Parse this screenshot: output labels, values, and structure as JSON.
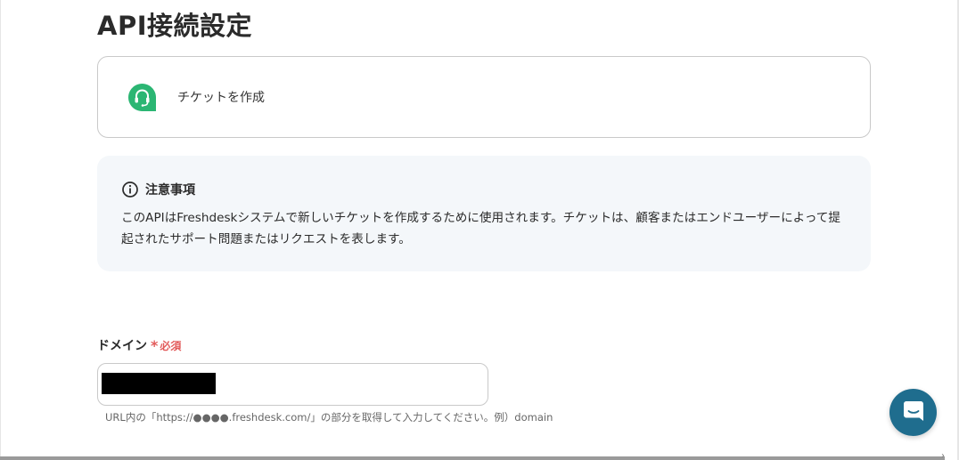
{
  "header": {
    "title": "API接続設定"
  },
  "action": {
    "app_icon": "freshdesk-headset-icon",
    "label": "チケットを作成"
  },
  "notice": {
    "icon": "info-circle-icon",
    "title": "注意事項",
    "body": "このAPIはFreshdeskシステムで新しいチケットを作成するために使用されます。チケットは、顧客またはエンドユーザーによって提起されたサポート問題またはリクエストを表します。"
  },
  "domain_field": {
    "label": "ドメイン",
    "required_mark": "*",
    "required_text": "必須",
    "value": "",
    "helper": "URL内の「https://●●●●.freshdesk.com/」の部分を取得して入力してください。例）domain"
  },
  "chat": {
    "icon": "chat-bubble-icon"
  },
  "colors": {
    "freshdesk_green": "#2bb673",
    "required_red": "#e25b5b",
    "notice_bg": "#f4f7fa",
    "chat_blue": "#1f6d8e"
  }
}
